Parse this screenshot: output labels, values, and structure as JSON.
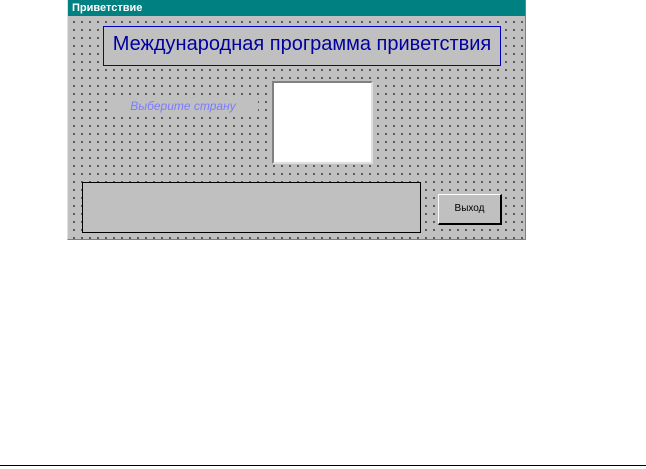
{
  "window": {
    "title": "Приветствие",
    "title_bar_color": "#008080",
    "background_color": "#c0c0c0"
  },
  "form": {
    "heading": "Международная программа приветствия",
    "heading_color": "#0000a0",
    "country_prompt": "Выберите страну",
    "country_prompt_color": "#7b7bff",
    "country_list_items": [],
    "output_text": "",
    "exit_button_label": "Выход"
  }
}
